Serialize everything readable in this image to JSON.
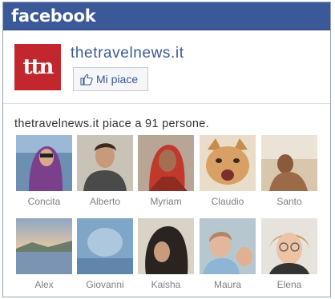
{
  "header": {
    "brand": "facebook"
  },
  "page": {
    "logo_text": "ttn",
    "name": "thetravelnews.it",
    "like_label": "Mi piace"
  },
  "summary": "thetravelnews.it piace a 91 persone.",
  "fans": [
    {
      "name": "Concita",
      "icon": "woman-headscarf-photo"
    },
    {
      "name": "Alberto",
      "icon": "man-portrait-photo"
    },
    {
      "name": "Myriam",
      "icon": "woman-red-scarf-photo"
    },
    {
      "name": "Claudio",
      "icon": "kitten-photo"
    },
    {
      "name": "Santo",
      "icon": "beach-photo"
    },
    {
      "name": "Alex",
      "icon": "sunset-lake-photo"
    },
    {
      "name": "Giovanni",
      "icon": "abstract-blue-photo"
    },
    {
      "name": "Kaisha",
      "icon": "woman-dark-hair-photo"
    },
    {
      "name": "Maura",
      "icon": "child-photo"
    },
    {
      "name": "Elena",
      "icon": "woman-glasses-photo"
    }
  ],
  "colors": {
    "brand_blue": "#3b5998",
    "logo_red": "#c1272d",
    "name_gray": "#808080"
  }
}
